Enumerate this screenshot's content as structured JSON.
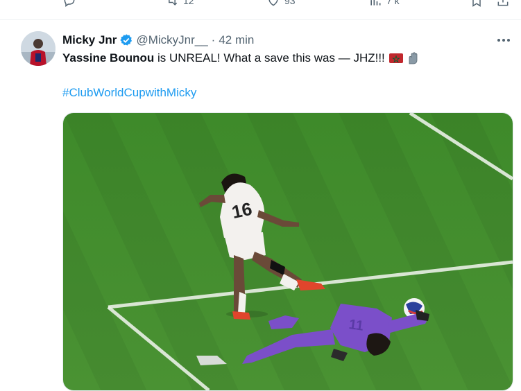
{
  "previous_tweet_actions": {
    "replies": {
      "icon": "reply-icon",
      "count": ""
    },
    "reposts": {
      "icon": "repost-icon",
      "count": "12"
    },
    "likes": {
      "icon": "heart-icon",
      "count": "93"
    },
    "views": {
      "icon": "views-icon",
      "count": "7 k"
    },
    "bookmark": {
      "icon": "bookmark-icon"
    },
    "share": {
      "icon": "share-icon"
    }
  },
  "tweet": {
    "author_name": "Micky Jnr",
    "verified": true,
    "handle": "@MickyJnr__",
    "separator": "·",
    "time": "42 min",
    "text_bold": "Yassine Bounou",
    "text_rest": " is UNREAL! What a save this was — JHZ!!!",
    "emojis": [
      "morocco-flag-icon",
      "goalkeeper-gloves-icon"
    ],
    "hashtag": "#ClubWorldCupwithMicky",
    "player_shirt_number": "16",
    "more_icon": "more-icon"
  },
  "colors": {
    "link": "#1d9bf0",
    "secondary": "#536471",
    "verified": "#1d9bf0",
    "pitch": "#3f8a2c"
  }
}
